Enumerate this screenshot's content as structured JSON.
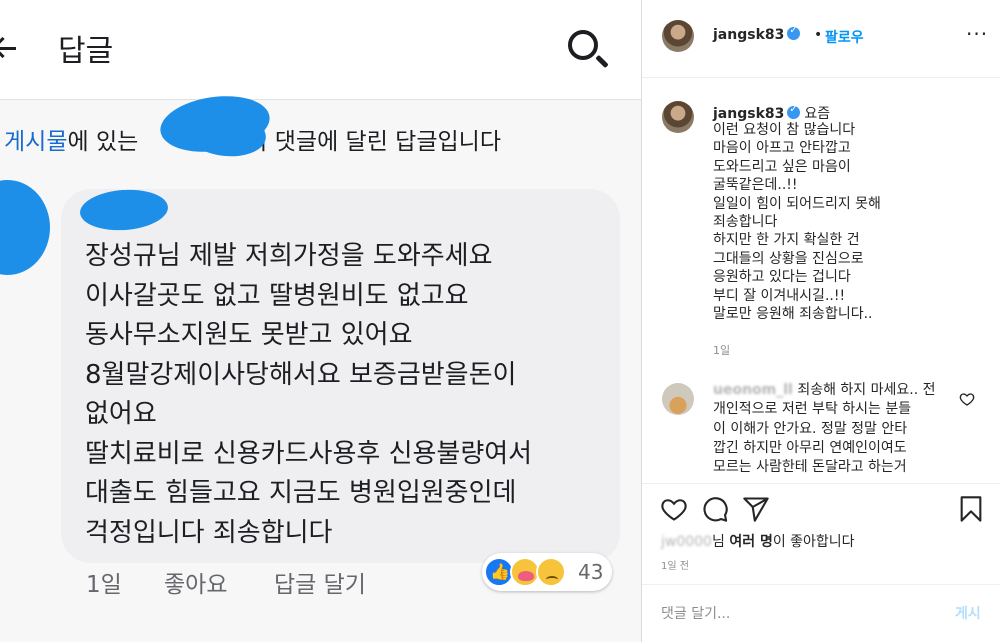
{
  "photo": {
    "header_title": "답글",
    "context_link": "게시물",
    "context_pre": "에 있는",
    "context_post": "의 댓글에 달린 답글입니다",
    "comment_lines": [
      "장성규님  제발  저희가정을  도와주세요",
      "이사갈곳도 없고  딸병원비도  없고요",
      "동사무소지원도 못받고 있어요",
      "8월말강제이사당해서요  보증금받을돈이",
      "없어요",
      "딸치료비로 신용카드사용후 신용불량여서",
      "대출도 힘들고요 지금도 병원입원중인데",
      "걱정입니다 죄송합니다"
    ],
    "action_time": "1일",
    "action_like": "좋아요",
    "action_reply": "답글 달기",
    "reaction_count": "43",
    "colors": {
      "link": "#1a6bd1",
      "redaction": "#1d8fe9",
      "bubble": "#efeff1"
    }
  },
  "ig": {
    "username": "jangsk83",
    "dot": "•",
    "follow": "팔로우",
    "more": "···",
    "caption_user": "jangsk83",
    "caption_first": "요즘",
    "caption_lines": [
      "이런 요청이 참 많습니다",
      "마음이 아프고 안타깝고",
      "도와드리고 싶은 마음이",
      "굴뚝같은데..!!",
      "일일이 힘이 되어드리지 못해",
      "죄송합니다",
      "하지만 한 가지 확실한 건",
      "그대들의 상황을 진심으로",
      "응원하고 있다는 겁니다",
      "부디 잘 이겨내시길..!!",
      "말로만 응원해 죄송합니다.."
    ],
    "caption_time": "1일",
    "comment_user": "ueonom_ll",
    "comment_first": "죄송해 하지 마세요.. 전",
    "comment_lines": [
      "개인적으로 저런 부탁 하시는 분들",
      "이 이해가 안가요. 정말 정말 안타",
      "깝긴 하지만 아무리 연예인이여도",
      "모르는 사람한테 돈달라고 하는거"
    ],
    "likes_user": "jw0000",
    "likes_mid": "님 ",
    "likes_bold": "여러 명",
    "likes_tail": "이 좋아합니다",
    "post_time": "1일 전",
    "comment_placeholder": "댓글 달기...",
    "post_button": "게시",
    "colors": {
      "follow": "#0095f6",
      "verified": "#3897f0",
      "muted": "#8e8e8e"
    },
    "icons": [
      "heart-icon",
      "comment-icon",
      "share-icon",
      "bookmark-icon",
      "verified-badge-icon",
      "more-icon"
    ]
  }
}
